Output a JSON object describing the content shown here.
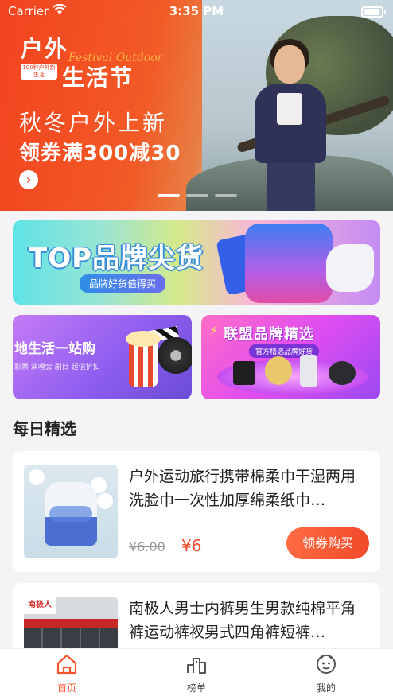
{
  "status_bar": {
    "carrier": "Carrier",
    "time": "3:35 PM"
  },
  "hero": {
    "logo_tag": "100种户外新生活",
    "logo_line1": "户外",
    "logo_line2": "生活节",
    "script_text": "Festival Outdoor",
    "headline": "秋冬户外上新",
    "promo": "领券满300减30",
    "slides_total": 3,
    "active_slide": 1
  },
  "banners": {
    "top": {
      "title": "TOP品牌尖货",
      "subtitle": "品牌好货值得买"
    },
    "left": {
      "title": "地生活一站购",
      "subtitle": "影票  演唱会  剧目  超值折扣"
    },
    "right": {
      "title": "联盟品牌精选",
      "subtitle": "官方精选品牌好货"
    }
  },
  "section": {
    "title": "每日精选"
  },
  "products": [
    {
      "title": "户外运动旅行携带棉柔巾干湿两用洗脸巾一次性加厚绵柔纸巾…",
      "old_price": "¥6.00",
      "new_price": "¥6",
      "button": "领券购买"
    },
    {
      "title": "南极人男士内裤男生男款纯棉平角裤运动裤衩男式四角裤短裤…",
      "brand_label": "南极人"
    }
  ],
  "tabbar": {
    "items": [
      {
        "label": "首页",
        "icon": "home-icon",
        "active": true
      },
      {
        "label": "榜单",
        "icon": "ranking-icon",
        "active": false
      },
      {
        "label": "我的",
        "icon": "profile-icon",
        "active": false
      }
    ],
    "active_color": "#f2542d"
  },
  "colors": {
    "accent": "#f24a2a",
    "hero_bg": "#f2431f"
  }
}
